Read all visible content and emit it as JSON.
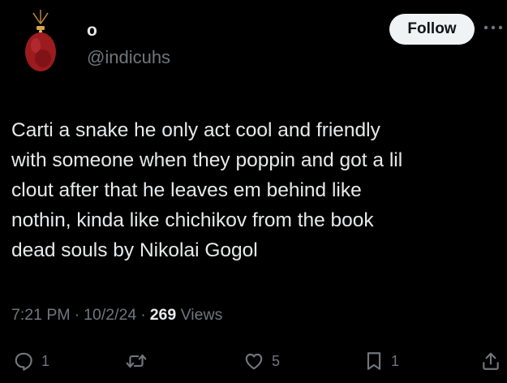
{
  "author": {
    "display_name": "o",
    "handle": "@indicuhs"
  },
  "follow_button": {
    "label": "Follow"
  },
  "more_icon": "more-horizontal-icon",
  "tweet": {
    "text": "Carti a snake he only act cool and friendly\nwith someone when they poppin and got a lil\nclout after that he leaves em behind like\nnothin, kinda like chichikov from the book\ndead souls by Nikolai Gogol",
    "time": "7:21 PM",
    "date": "10/2/24",
    "separator": "·",
    "views_count": "269",
    "views_label": "Views"
  },
  "actions": {
    "reply": {
      "icon": "reply-icon",
      "count": "1"
    },
    "repost": {
      "icon": "repost-icon",
      "count": ""
    },
    "like": {
      "icon": "heart-icon",
      "count": "5"
    },
    "bookmark": {
      "icon": "bookmark-icon",
      "count": "1"
    },
    "share": {
      "icon": "share-icon"
    }
  },
  "colors": {
    "background": "#000000",
    "primary_text": "#e7e9ea",
    "secondary_text": "#71767b",
    "follow_bg": "#eff3f4",
    "avatar_red": "#9b1b1f"
  }
}
